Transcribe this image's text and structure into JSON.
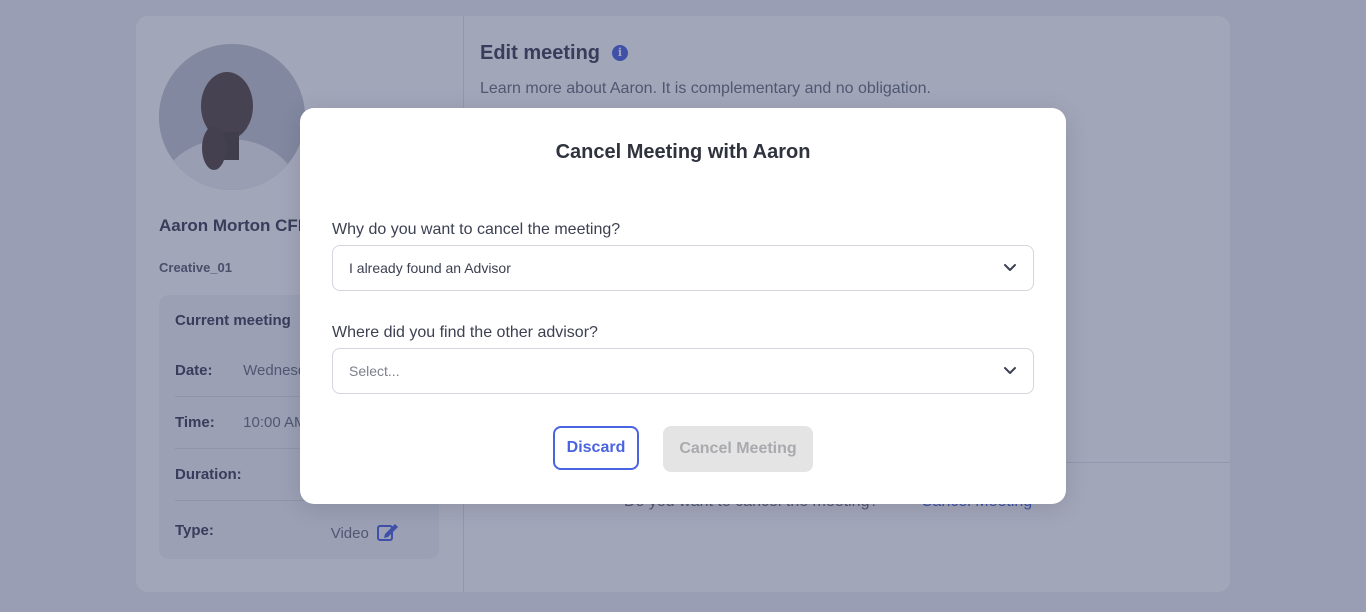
{
  "background": {
    "advisor": {
      "name": "Aaron Morton CFP® CFP®",
      "handle": "Creative_01"
    },
    "current_meeting": {
      "title": "Current meeting",
      "rows": [
        {
          "label": "Date:",
          "value": "Wednesday"
        },
        {
          "label": "Time:",
          "value": "10:00 AM"
        },
        {
          "label": "Duration:",
          "value": ""
        },
        {
          "label": "Type:",
          "value": "Video"
        }
      ]
    },
    "edit": {
      "title": "Edit meeting",
      "description": "Learn more about Aaron. It is complementary and no obligation."
    },
    "bottom": {
      "question": "Do you want to cancel the meeting?",
      "cancel_link": "Cancel Meeting"
    }
  },
  "modal": {
    "title": "Cancel Meeting with Aaron",
    "reason": {
      "label": "Why do you want to cancel the meeting?",
      "selected": "I already found an Advisor"
    },
    "source": {
      "label": "Where did you find the other advisor?",
      "placeholder": "Select..."
    },
    "discard_label": "Discard",
    "cancel_meeting_label": "Cancel Meeting"
  },
  "colors": {
    "accent": "#4a63e0",
    "overlay": "#303a64",
    "disabled_button": "#e4e4e4"
  },
  "icons": {
    "info": "info-icon",
    "edit": "edit-icon",
    "chevron": "chevron-down-icon"
  }
}
